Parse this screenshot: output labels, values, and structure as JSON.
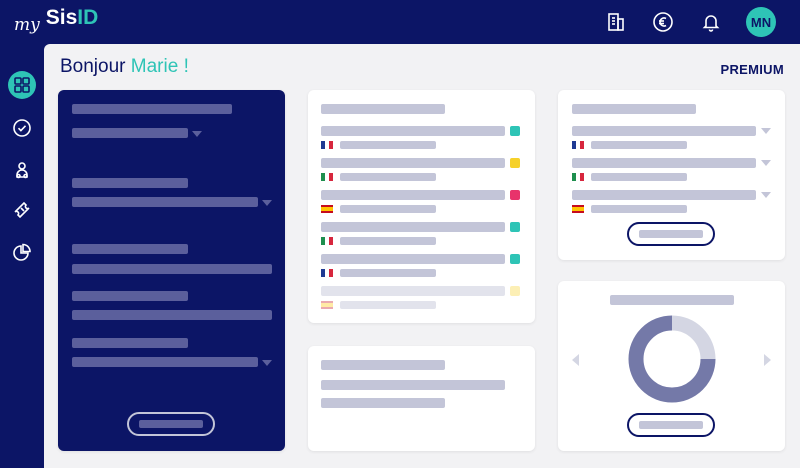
{
  "header": {
    "logo": {
      "prefix": "my",
      "sis": "Sis",
      "id": "ID"
    },
    "icons": [
      "building-icon",
      "euro-icon",
      "bell-icon"
    ],
    "avatar_initials": "MN"
  },
  "sidebar": {
    "items": [
      {
        "icon": "dashboard-grid-icon",
        "active": true
      },
      {
        "icon": "check-circle-icon",
        "active": false
      },
      {
        "icon": "users-icon",
        "active": false
      },
      {
        "icon": "ticket-icon",
        "active": false
      },
      {
        "icon": "pie-chart-icon",
        "active": false
      }
    ]
  },
  "main": {
    "greeting_prefix": "Bonjour",
    "greeting_name": "Marie !",
    "plan": "PREMIUM"
  },
  "colors": {
    "navy": "#0c1566",
    "teal": "#2ec4b6",
    "yellow": "#f6d12a",
    "pink": "#e8336b",
    "placeholder": "#c3c5d8"
  },
  "list_card": {
    "rows": [
      {
        "flag": "fr",
        "status": "#2ec4b6"
      },
      {
        "flag": "it",
        "status": "#f6d12a"
      },
      {
        "flag": "es",
        "status": "#e8336b"
      },
      {
        "flag": "it",
        "status": "#2ec4b6"
      },
      {
        "flag": "fr",
        "status": "#2ec4b6"
      },
      {
        "flag": "es",
        "status": "#f6d12a",
        "faded": true
      }
    ]
  },
  "dropdown_card": {
    "rows": [
      {
        "flag": "fr"
      },
      {
        "flag": "it"
      },
      {
        "flag": "es"
      }
    ]
  },
  "donut_card": {
    "segments": [
      0.25,
      0.75
    ]
  }
}
